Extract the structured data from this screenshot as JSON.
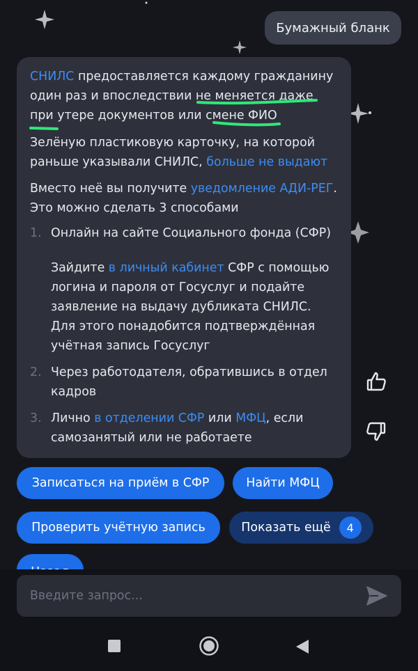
{
  "user_message": "Бумажный бланк",
  "bot_message": {
    "p1": {
      "link_snils": "СНИЛС",
      "text_a": " предоставляется каждому гражданину один раз и впоследствии ",
      "underlined": "не меняется даже при утере документов",
      "text_b": " или ",
      "underlined_2": "смене ФИО"
    },
    "p2": {
      "text_a": "Зелёную пластиковую карточку, на которой раньше указывали СНИЛС, ",
      "link": "больше не выдают"
    },
    "p3": {
      "text_a": "Вместо неё вы получите ",
      "link": "уведомление АДИ-РЕГ",
      "text_b": ". Это можно сделать 3 способами"
    },
    "list": [
      {
        "num": "1.",
        "title": "Онлайн на сайте Социального фонда (СФР)",
        "sub_a": "Зайдите ",
        "sub_link": "в личный кабинет",
        "sub_b": " СФР с помощью логина и пароля от Госуслуг и подайте заявление на выдачу дубликата СНИЛС. Для этого понадобится подтверждённая учётная запись Госуслуг"
      },
      {
        "num": "2.",
        "text": "Через работодателя, обратившись в отдел кадров"
      },
      {
        "num": "3.",
        "text_a": "Лично ",
        "link_a": "в отделении СФР",
        "text_b": " или ",
        "link_b": "МФЦ",
        "text_c": ", если самозанятый или не работаете"
      }
    ]
  },
  "reactions": {
    "like_icon": "thumbs-up-icon",
    "dislike_icon": "thumbs-down-icon"
  },
  "quick_replies": [
    "Записаться на приём в СФР",
    "Найти МФЦ",
    "Проверить учётную запись",
    "Показать ещё"
  ],
  "more_count": "4",
  "partial_chip": "Назад",
  "input": {
    "placeholder": "Введите запрос..."
  },
  "nav": [
    "square-icon",
    "circle-icon",
    "triangle-back-icon"
  ],
  "colors": {
    "background": "#15161c",
    "bubble": "#2e313b",
    "link": "#3d8cf5",
    "chip_primary": "#1d6ee8",
    "chip_dark": "#16356d",
    "highlight": "#2ee87a"
  }
}
